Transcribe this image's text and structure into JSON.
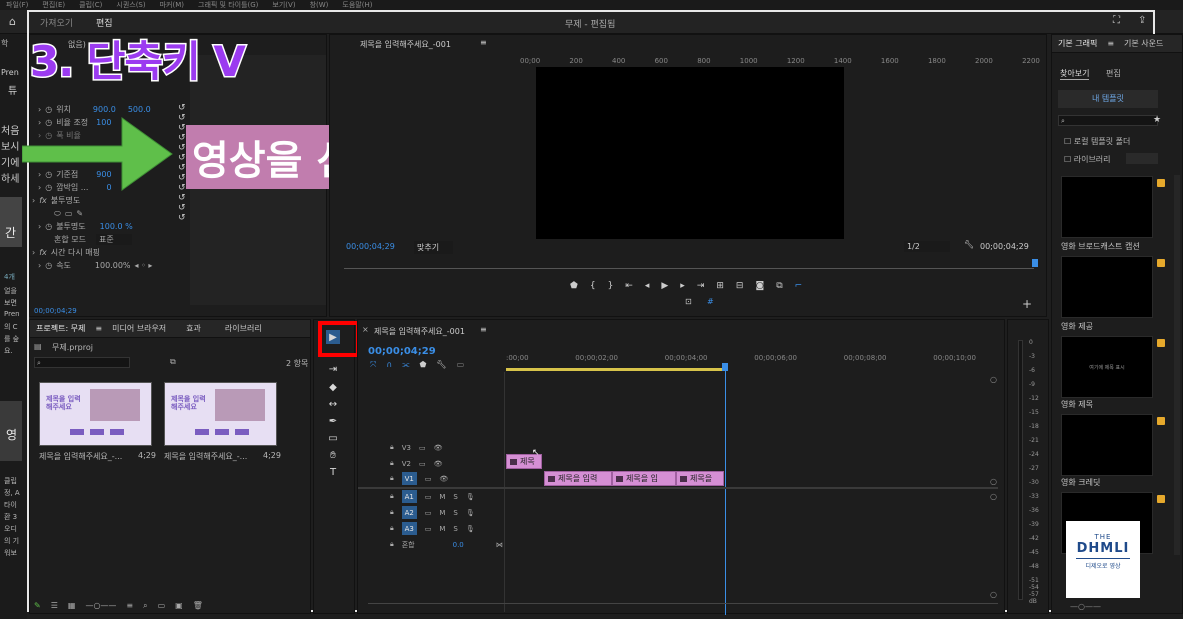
{
  "menu": {
    "items": [
      "파일(F)",
      "편집(E)",
      "클립(C)",
      "시퀀스(S)",
      "마커(M)",
      "그래픽 및 타이틀(G)",
      "보기(V)",
      "창(W)",
      "도움말(H)"
    ]
  },
  "title": {
    "app_title": "무제 - 편집됨",
    "left_tab": "가져오기",
    "edit_tab": "편집"
  },
  "overlay": {
    "heading": "3. 단축키 V",
    "caption": "영상을 선택하는 역할"
  },
  "effects": {
    "header_frag": "없음)",
    "rows": {
      "pos": "위치",
      "pos_x": "900.0",
      "pos_y": "500.0",
      "scale": "비율 조정",
      "scale_val": "100",
      "ratio": "폭 비율",
      "anchor": "기준점",
      "anchor_val": "900",
      "flicker": "깜박임 ...",
      "flicker_val": "0",
      "opacity": "불투명도",
      "opacity_prop": "불투명도",
      "opacity_val": "100.0 %",
      "blend": "혼합 모드",
      "blend_val": "표준",
      "remap": "시간 다시 매핑",
      "speed": "속도",
      "speed_val": "100.00%"
    },
    "timecode": "00;00;04;29",
    "fx_label": "fx"
  },
  "left_edge": {
    "lines": [
      "학",
      "Pren",
      "튜",
      "처음",
      "보시",
      "기에",
      "하세",
      "간",
      "4개",
      "얼을",
      "보면",
      "Pren",
      "의 C",
      "를 숲",
      "요.",
      "영",
      "클립",
      "정, A",
      "타이",
      "환 3",
      "오디",
      "의 기",
      "워보"
    ]
  },
  "program": {
    "tab": "제목을 입력해주세요_-001",
    "ruler": [
      "00;00",
      "200",
      "400",
      "600",
      "800",
      "1000",
      "1200",
      "1400",
      "1600",
      "1800",
      "2000",
      "2200"
    ],
    "timecode_left": "00;00;04;29",
    "fit": "맞추기",
    "quality": "1/2",
    "timecode_right": "00;00;04;29"
  },
  "project": {
    "tabs": [
      "프로젝트: 무제",
      "미디어 브라우저",
      "효과",
      "라이브러리"
    ],
    "file": "무제.prproj",
    "count": "2 항목",
    "items": [
      {
        "name": "제목을 입력해주세요_-...",
        "dur": "4;29"
      },
      {
        "name": "제목을 입력해주세요_-...",
        "dur": "4;29"
      }
    ],
    "thumb_text": "제목을 입력해주세요"
  },
  "timeline": {
    "tab": "제목을 입력해주세요_-001",
    "timecode": "00;00;04;29",
    "ruler": [
      ":00;00",
      "00;00;02;00",
      "00;00;04;00",
      "00;00;06;00",
      "00;00;08;00",
      "00;00;10;00"
    ],
    "tracks": {
      "v3": "V3",
      "v2": "V2",
      "v1": "V1",
      "a1": "A1",
      "a2": "A2",
      "a3": "A3",
      "mix": "혼합",
      "mix_val": "0.0",
      "m": "M",
      "s": "S"
    },
    "clips": {
      "v2_clip": "제목",
      "v1_a": "제목을 입력",
      "v1_b": "제목을 입",
      "v1_c": "제목을"
    }
  },
  "meter": {
    "labels": [
      "0",
      "-3",
      "-6",
      "-9",
      "-12",
      "-15",
      "-18",
      "-21",
      "-24",
      "-27",
      "-30",
      "-33",
      "-36",
      "-39",
      "-42",
      "-45",
      "-48",
      "-51",
      "-54",
      "-57",
      "dB"
    ]
  },
  "right": {
    "tabs": [
      "기본 그래픽",
      "기본 사운드"
    ],
    "subtabs": [
      "찾아보기",
      "편집"
    ],
    "my_templates": "내 템플릿",
    "local_folder": "로컬 템플릿 폴더",
    "library": "라이브러리",
    "items": [
      "영화 브로드캐스트 캡션",
      "영화 제공",
      "영화 제목",
      "영화 크레딧"
    ],
    "tile_texts": [
      "",
      "",
      "여기에 제목 표시",
      "",
      ""
    ],
    "logo": {
      "the": "THE",
      "name": "DHMLI",
      "sub": "디제오로 영상"
    }
  },
  "colors": {
    "accent": "#3a8ee6",
    "clip": "#d58fd4",
    "overlay_purple": "#9b3bf0",
    "caption_bg": "#c17dae",
    "highlight_red": "#ff0000"
  }
}
